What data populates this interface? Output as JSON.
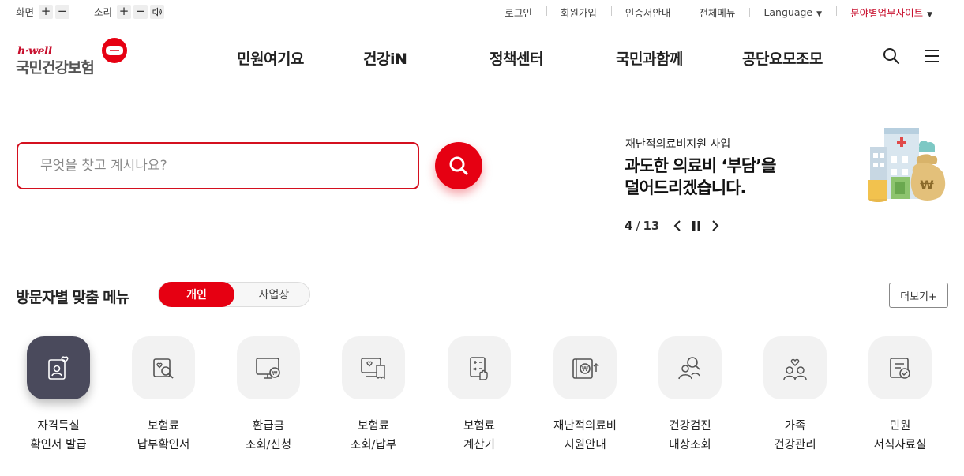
{
  "utility": {
    "screen_label": "화면",
    "sound_label": "소리",
    "plus": "+",
    "minus": "−",
    "links": [
      "로그인",
      "회원가입",
      "인증서안내",
      "전체메뉴"
    ],
    "language": "Language",
    "field_sites": "분야별업무사이트",
    "accent": "#c8102e"
  },
  "logo": {
    "small": "h·well",
    "name": "국민건강보험"
  },
  "gnb": {
    "items": [
      "민원여기요",
      "건강iN",
      "정책센터",
      "국민과함께",
      "공단요모조모"
    ],
    "icons": [
      "search-icon",
      "hamburger-menu-icon"
    ]
  },
  "search": {
    "placeholder": "무엇을 찾고 계시나요?",
    "button_color": "#e60012"
  },
  "banner": {
    "subtitle": "재난적의료비지원 사업",
    "title_line1": "과도한 의료비 ‘부담’을",
    "title_line2": "덜어드리겠습니다.",
    "current": "4",
    "separator": "/",
    "total": "13"
  },
  "visitor_menu": {
    "title": "방문자별 맞춤 메뉴",
    "tab_personal": "개인",
    "tab_business": "사업장",
    "more": "더보기+",
    "items": [
      {
        "line1": "자격득실",
        "line2": "확인서 발급",
        "icon": "id-card-heart-icon"
      },
      {
        "line1": "보험료",
        "line2": "납부확인서",
        "icon": "document-search-icon"
      },
      {
        "line1": "환급금",
        "line2": "조회/신청",
        "icon": "monitor-won-icon"
      },
      {
        "line1": "보험료",
        "line2": "조회/납부",
        "icon": "monitor-receipt-icon"
      },
      {
        "line1": "보험료",
        "line2": "계산기",
        "icon": "calculator-hand-icon"
      },
      {
        "line1": "재난적의료비",
        "line2": "지원안내",
        "icon": "wallet-won-icon"
      },
      {
        "line1": "건강검진",
        "line2": "대상조회",
        "icon": "people-search-icon"
      },
      {
        "line1": "가족",
        "line2": "건강관리",
        "icon": "family-heart-icon"
      },
      {
        "line1": "민원",
        "line2": "서식자료실",
        "icon": "form-check-icon"
      }
    ]
  }
}
